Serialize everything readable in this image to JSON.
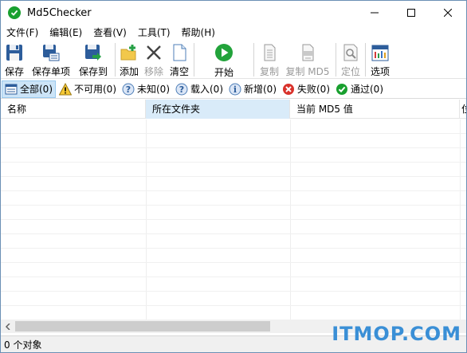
{
  "window": {
    "title": "Md5Checker"
  },
  "menu": [
    "文件(F)",
    "编辑(E)",
    "查看(V)",
    "工具(T)",
    "帮助(H)"
  ],
  "toolbar": {
    "save": "保存",
    "save_single": "保存单项",
    "save_to": "保存到",
    "add": "添加",
    "remove": "移除",
    "clear": "清空",
    "start": "开始",
    "copy": "复制",
    "copy_md5": "复制 MD5",
    "locate": "定位",
    "options": "选项"
  },
  "filters": [
    {
      "label": "全部(0)",
      "icon": "list-icon"
    },
    {
      "label": "不可用(0)",
      "icon": "warning-icon"
    },
    {
      "label": "未知(0)",
      "icon": "question-icon"
    },
    {
      "label": "载入(0)",
      "icon": "load-icon"
    },
    {
      "label": "新增(0)",
      "icon": "info-icon"
    },
    {
      "label": "失败(0)",
      "icon": "fail-icon"
    },
    {
      "label": "通过(0)",
      "icon": "pass-icon"
    }
  ],
  "columns": [
    "名称",
    "所在文件夹",
    "当前 MD5 值",
    "位"
  ],
  "status": {
    "text": "0 个对象"
  },
  "watermark": "ITMOP.COM",
  "colors": {
    "accent": "#19a02f",
    "selected": "#cce4f7",
    "sorted_column": "#d9ebf9"
  }
}
